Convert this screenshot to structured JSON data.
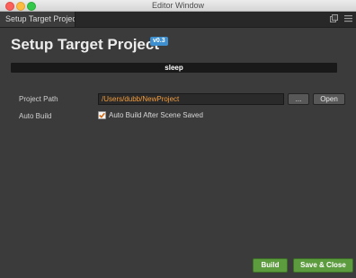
{
  "window": {
    "title": "Editor Window"
  },
  "tab": {
    "label": "Setup Target Project"
  },
  "icons": {
    "popout": "window-popout-icon",
    "menu": "menu-icon",
    "check": "checkmark-icon"
  },
  "header": {
    "title": "Setup Target Project",
    "version": "v0.3"
  },
  "status": {
    "text": "sleep"
  },
  "form": {
    "project_path_label": "Project Path",
    "project_path_value": "/Users/dubb/NewProject",
    "browse_label": "...",
    "open_label": "Open",
    "auto_build_label": "Auto Build",
    "auto_build_checked": true,
    "auto_build_option": "Auto Build After Scene Saved"
  },
  "footer": {
    "build_label": "Build",
    "save_close_label": "Save & Close"
  },
  "colors": {
    "accent_orange": "#f39c3c",
    "version_badge": "#3d8fd0",
    "green_button": "#5d9b3f",
    "background": "#3b3b3b"
  }
}
